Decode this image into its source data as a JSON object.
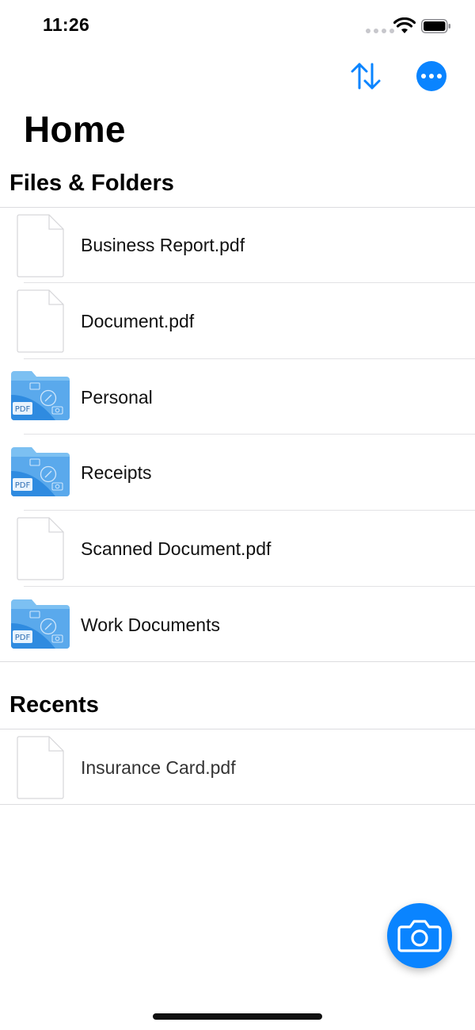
{
  "status_bar": {
    "time": "11:26"
  },
  "nav": {
    "sort_icon": "sort-arrows-icon",
    "more_icon": "ellipsis-icon"
  },
  "page": {
    "title": "Home"
  },
  "files_section": {
    "title": "Files & Folders",
    "items": [
      {
        "label": "Business Report.pdf",
        "kind": "document"
      },
      {
        "label": "Document.pdf",
        "kind": "document"
      },
      {
        "label": "Personal",
        "kind": "folder"
      },
      {
        "label": "Receipts",
        "kind": "folder"
      },
      {
        "label": "Scanned Document.pdf",
        "kind": "document"
      },
      {
        "label": "Work Documents",
        "kind": "folder"
      }
    ]
  },
  "folder_badge": "PDF",
  "recents_section": {
    "title": "Recents",
    "items": [
      {
        "label": "Insurance Card.pdf",
        "kind": "document"
      }
    ]
  },
  "colors": {
    "accent": "#0a84ff",
    "folder_light": "#7cc0f2",
    "folder_dark": "#2f8be0"
  }
}
